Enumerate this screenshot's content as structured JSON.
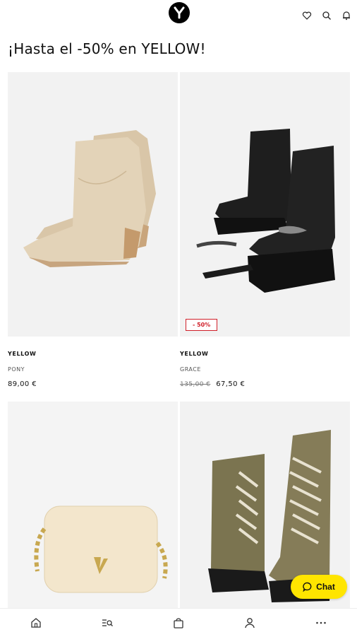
{
  "header": {
    "logo_letter": "Y"
  },
  "page": {
    "title": "¡Hasta el -50% en YELLOW!"
  },
  "products": [
    {
      "brand": "YELLOW",
      "model": "PONY",
      "price": "89,00 €",
      "old_price": "",
      "badge": ""
    },
    {
      "brand": "YELLOW",
      "model": "GRACE",
      "price": "67,50 €",
      "old_price": "135,00 €",
      "badge": "- 50%"
    },
    {
      "brand": "",
      "model": "",
      "price": "",
      "old_price": "",
      "badge": ""
    },
    {
      "brand": "",
      "model": "",
      "price": "",
      "old_price": "",
      "badge": ""
    }
  ],
  "chat": {
    "label": "Chat"
  },
  "colors": {
    "accent": "#ffe500",
    "sale": "#d0202a"
  },
  "nav": {
    "items": [
      "home-icon",
      "search-list-icon",
      "bag-icon",
      "user-icon",
      "more-icon"
    ]
  }
}
